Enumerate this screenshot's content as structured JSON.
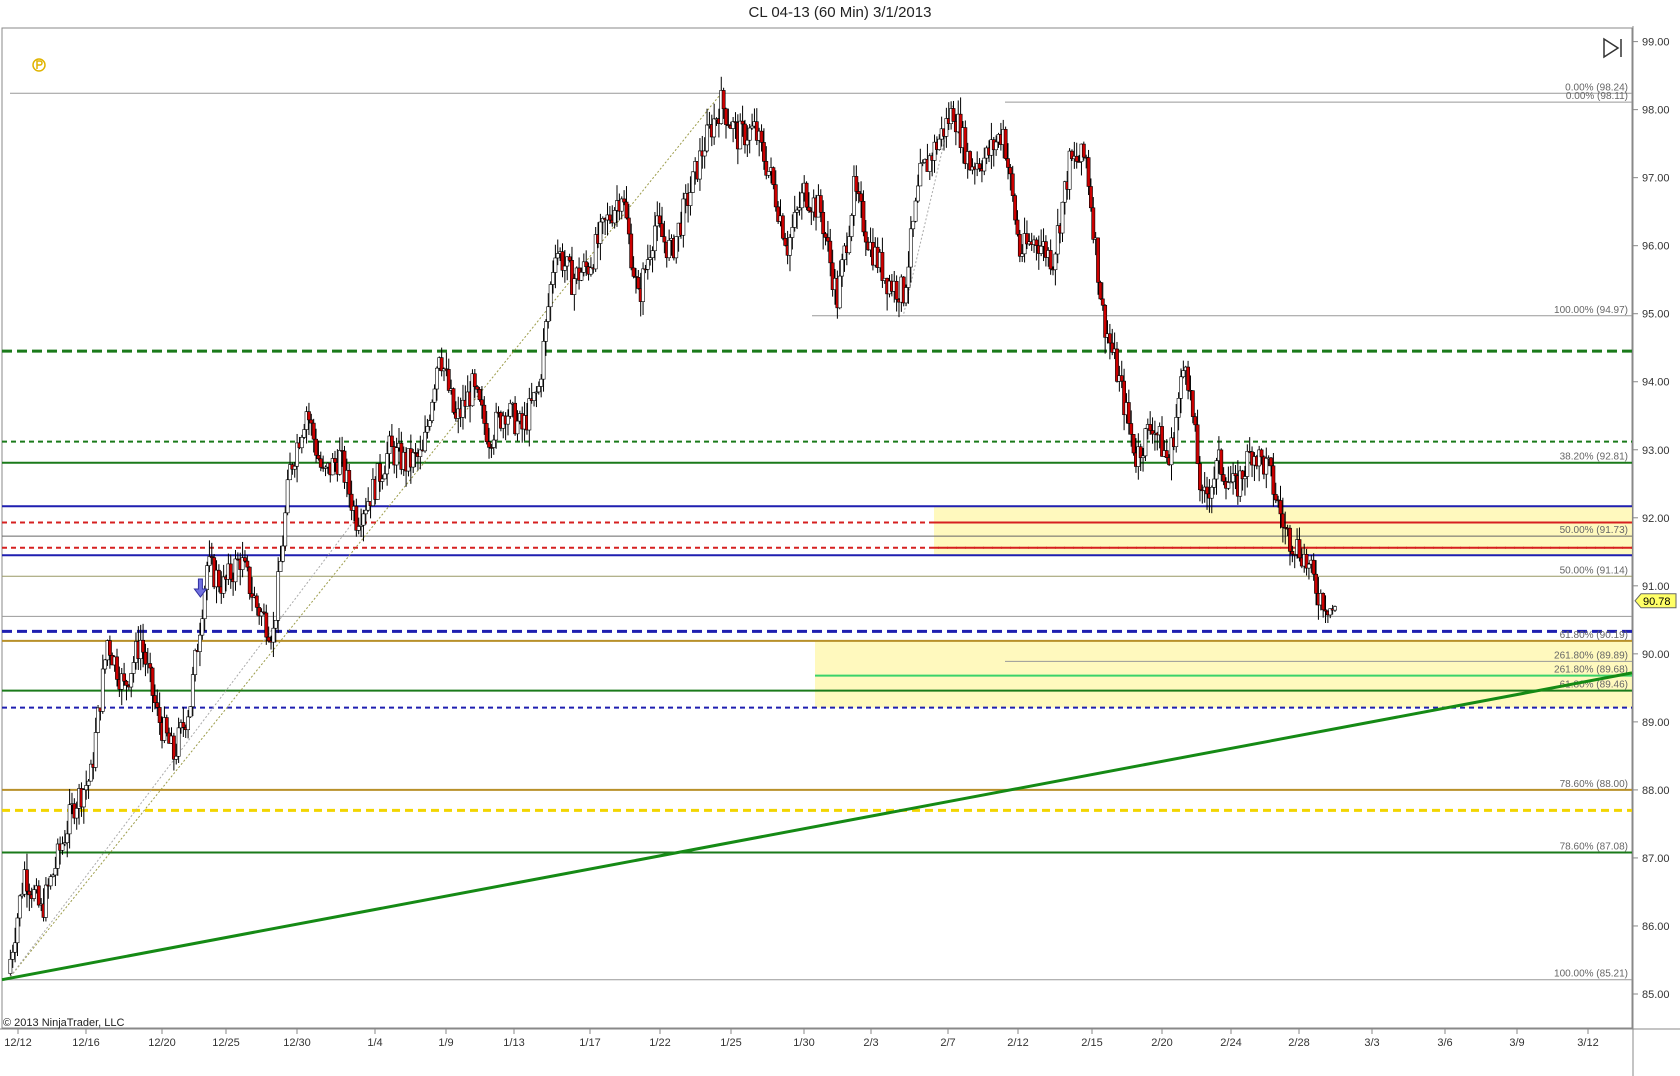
{
  "window": {
    "title": "CL 04-13 (60 Min)  3/1/2013"
  },
  "footer": {
    "copyright": "© 2013 NinjaTrader, LLC"
  },
  "icons": {
    "logo": "ninjatrader-logo-icon",
    "playback": "skip-to-end-icon",
    "marker": "down-arrow-icon"
  },
  "colors": {
    "up": "#ffffff",
    "down": "#cc0000",
    "wick": "#000000",
    "green_dark": "#1a7a1a",
    "green_bright": "#158a15",
    "blue": "#1f1fb0",
    "red": "#d62020",
    "gold": "#b8902a",
    "yellow": "#f2d500",
    "highlight": "#fff8b3"
  },
  "chart_data": {
    "type": "candlestick",
    "title": "CL 04-13 (60 Min)  3/1/2013",
    "ylim": [
      84.5,
      99.2
    ],
    "y_ticks": [
      "85.00",
      "86.00",
      "87.00",
      "88.00",
      "89.00",
      "90.00",
      "91.00",
      "92.00",
      "93.00",
      "94.00",
      "95.00",
      "96.00",
      "97.00",
      "98.00",
      "99.00"
    ],
    "x_ticks": [
      "12/12",
      "12/16",
      "12/20",
      "12/25",
      "12/30",
      "1/4",
      "1/9",
      "1/13",
      "1/17",
      "1/22",
      "1/25",
      "1/30",
      "2/3",
      "2/7",
      "2/12",
      "2/15",
      "2/20",
      "2/24",
      "2/28",
      "3/3",
      "3/6",
      "3/9",
      "3/12"
    ],
    "last_price": "90.78",
    "price_path": [
      [
        0,
        85.3
      ],
      [
        1,
        86.8
      ],
      [
        2,
        86.2
      ],
      [
        3,
        87.0
      ],
      [
        4,
        87.8
      ],
      [
        5,
        88.2
      ],
      [
        6,
        90.2
      ],
      [
        7,
        89.5
      ],
      [
        8,
        90.2
      ],
      [
        9,
        89.1
      ],
      [
        10,
        88.5
      ],
      [
        11,
        89.3
      ],
      [
        12,
        91.3
      ],
      [
        13,
        91.0
      ],
      [
        14,
        91.4
      ],
      [
        15,
        90.7
      ],
      [
        16,
        90.3
      ],
      [
        17,
        92.7
      ],
      [
        18,
        93.6
      ],
      [
        19,
        92.6
      ],
      [
        20,
        92.9
      ],
      [
        21,
        92.0
      ],
      [
        22,
        92.4
      ],
      [
        23,
        93.0
      ],
      [
        24,
        92.8
      ],
      [
        25,
        92.9
      ],
      [
        26,
        94.5
      ],
      [
        27,
        93.4
      ],
      [
        28,
        93.9
      ],
      [
        29,
        93.2
      ],
      [
        30,
        93.6
      ],
      [
        31,
        93.3
      ],
      [
        32,
        93.9
      ],
      [
        33,
        96.0
      ],
      [
        34,
        95.5
      ],
      [
        35,
        95.7
      ],
      [
        36,
        96.3
      ],
      [
        37,
        96.8
      ],
      [
        38,
        95.2
      ],
      [
        39,
        96.3
      ],
      [
        40,
        95.9
      ],
      [
        41,
        96.7
      ],
      [
        42,
        97.5
      ],
      [
        43,
        98.1
      ],
      [
        44,
        97.6
      ],
      [
        45,
        97.7
      ],
      [
        46,
        97.0
      ],
      [
        47,
        96.0
      ],
      [
        48,
        96.8
      ],
      [
        49,
        96.5
      ],
      [
        50,
        95.2
      ],
      [
        51,
        96.8
      ],
      [
        52,
        96.0
      ],
      [
        53,
        95.5
      ],
      [
        54,
        95.3
      ],
      [
        55,
        97.0
      ],
      [
        56,
        97.5
      ],
      [
        57,
        98.0
      ],
      [
        58,
        97.2
      ],
      [
        59,
        97.3
      ],
      [
        60,
        97.7
      ],
      [
        61,
        95.9
      ],
      [
        62,
        96.1
      ],
      [
        63,
        95.8
      ],
      [
        64,
        97.2
      ],
      [
        65,
        97.3
      ],
      [
        66,
        95.0
      ],
      [
        67,
        94.0
      ],
      [
        68,
        92.9
      ],
      [
        69,
        93.4
      ],
      [
        70,
        92.8
      ],
      [
        71,
        94.4
      ],
      [
        72,
        92.2
      ],
      [
        73,
        92.8
      ],
      [
        74,
        92.4
      ],
      [
        75,
        93.0
      ],
      [
        76,
        92.7
      ],
      [
        77,
        91.8
      ],
      [
        78,
        91.5
      ],
      [
        79,
        90.9
      ],
      [
        80,
        90.6
      ]
    ],
    "levels": [
      {
        "price": 98.24,
        "label": "0.00% (98.24)",
        "style": "thin-gray"
      },
      {
        "price": 98.11,
        "label": "0.00% (98.11)",
        "style": "thin-gray"
      },
      {
        "price": 94.97,
        "label": "100.00% (94.97)",
        "style": "thin-gray"
      },
      {
        "price": 94.45,
        "label": "",
        "style": "green-dash-thick"
      },
      {
        "price": 93.12,
        "label": "",
        "style": "green-dash"
      },
      {
        "price": 92.81,
        "label": "38.20% (92.81)",
        "style": "green"
      },
      {
        "price": 92.17,
        "label": "",
        "style": "blue"
      },
      {
        "price": 91.93,
        "label": "",
        "style": "red-dash"
      },
      {
        "price": 91.73,
        "label": "50.00% (91.73)",
        "style": "gray"
      },
      {
        "price": 91.56,
        "label": "",
        "style": "red-dash"
      },
      {
        "price": 91.45,
        "label": "",
        "style": "blue"
      },
      {
        "price": 91.14,
        "label": "50.00% (91.14)",
        "style": "olive"
      },
      {
        "price": 90.55,
        "label": "",
        "style": "thin-gray"
      },
      {
        "price": 90.33,
        "label": "",
        "style": "blue-dash-thick"
      },
      {
        "price": 90.19,
        "label": "61.80% (90.19)",
        "style": "gold"
      },
      {
        "price": 89.89,
        "label": "261.80% (89.89)",
        "style": "thin-gray"
      },
      {
        "price": 89.68,
        "label": "261.80% (89.68)",
        "style": "lightgreen"
      },
      {
        "price": 89.46,
        "label": "61.80% (89.46)",
        "style": "green"
      },
      {
        "price": 89.21,
        "label": "",
        "style": "blue-dash"
      },
      {
        "price": 88.0,
        "label": "78.60% (88.00)",
        "style": "gold"
      },
      {
        "price": 87.7,
        "label": "",
        "style": "yellow-dash"
      },
      {
        "price": 87.08,
        "label": "78.60% (87.08)",
        "style": "green"
      },
      {
        "price": 85.21,
        "label": "100.00% (85.21)",
        "style": "thin-gray"
      }
    ],
    "zones": [
      {
        "top": 92.17,
        "bottom": 91.45
      },
      {
        "top": 90.19,
        "bottom": 89.21
      }
    ],
    "trendline": {
      "from": [
        0,
        85.21
      ],
      "to": [
        1,
        89.72
      ]
    }
  }
}
